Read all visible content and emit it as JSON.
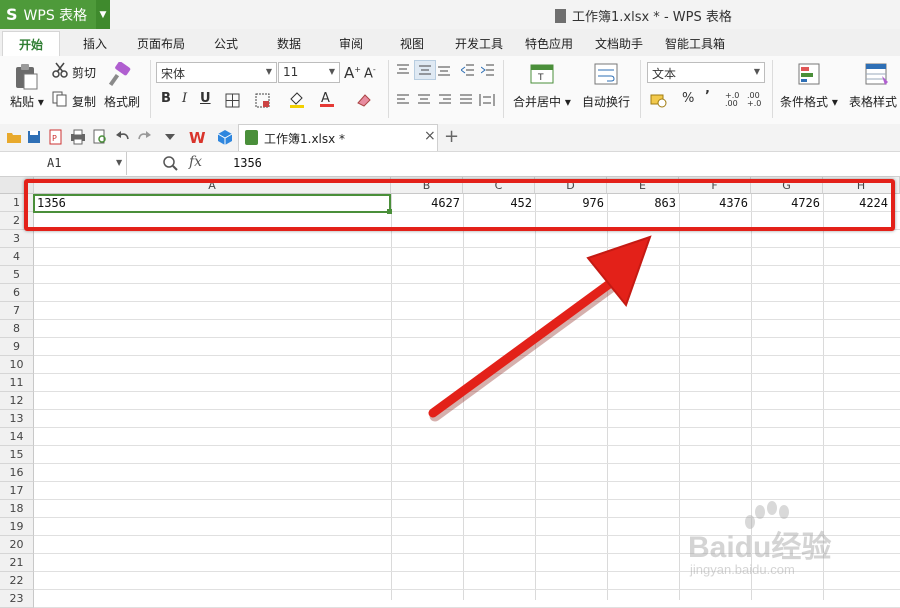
{
  "app": {
    "logo_glyph": "S",
    "logo_text": "WPS 表格",
    "window_title": "工作簿1.xlsx * - WPS 表格",
    "accent": "#4e9a3a"
  },
  "menu_tabs": [
    "开始",
    "插入",
    "页面布局",
    "公式",
    "数据",
    "审阅",
    "视图",
    "开发工具",
    "特色应用",
    "文档助手",
    "智能工具箱"
  ],
  "ribbon": {
    "paste": "粘贴",
    "cut": "剪切",
    "copy": "复制",
    "format_painter": "格式刷",
    "font_name": "宋体",
    "font_size": "11",
    "merge_center": "合并居中",
    "wrap_text": "自动换行",
    "number_format": "文本",
    "conditional_format": "条件格式",
    "table_style": "表格样式",
    "bold": "B",
    "italic": "I",
    "underline": "U",
    "percent": "%",
    "comma": "’",
    "dec_inc": "+.0 .00",
    "dec_dec": ".00 +.0"
  },
  "doc_tab": {
    "name": "工作簿1.xlsx *",
    "close": "×",
    "new": "+"
  },
  "formula_bar": {
    "cell_ref": "A1",
    "fx": "fx",
    "content": "1356"
  },
  "columns": [
    "A",
    "B",
    "C",
    "D",
    "E",
    "F",
    "G",
    "H"
  ],
  "rows": [
    "1",
    "2",
    "3",
    "4",
    "5",
    "6",
    "7",
    "8",
    "9",
    "10",
    "11",
    "12",
    "13",
    "14",
    "15",
    "16",
    "17",
    "18",
    "19",
    "20",
    "21",
    "22",
    "23"
  ],
  "row1_values": [
    "1356",
    "4627",
    "452",
    "976",
    "863",
    "4376",
    "4726",
    "4224"
  ],
  "colors": {
    "highlight_red": "#e32119",
    "selection_green": "#4a8f3a"
  },
  "watermark": {
    "brand": "Baidu经验",
    "url": "jingyan.baidu.com"
  }
}
